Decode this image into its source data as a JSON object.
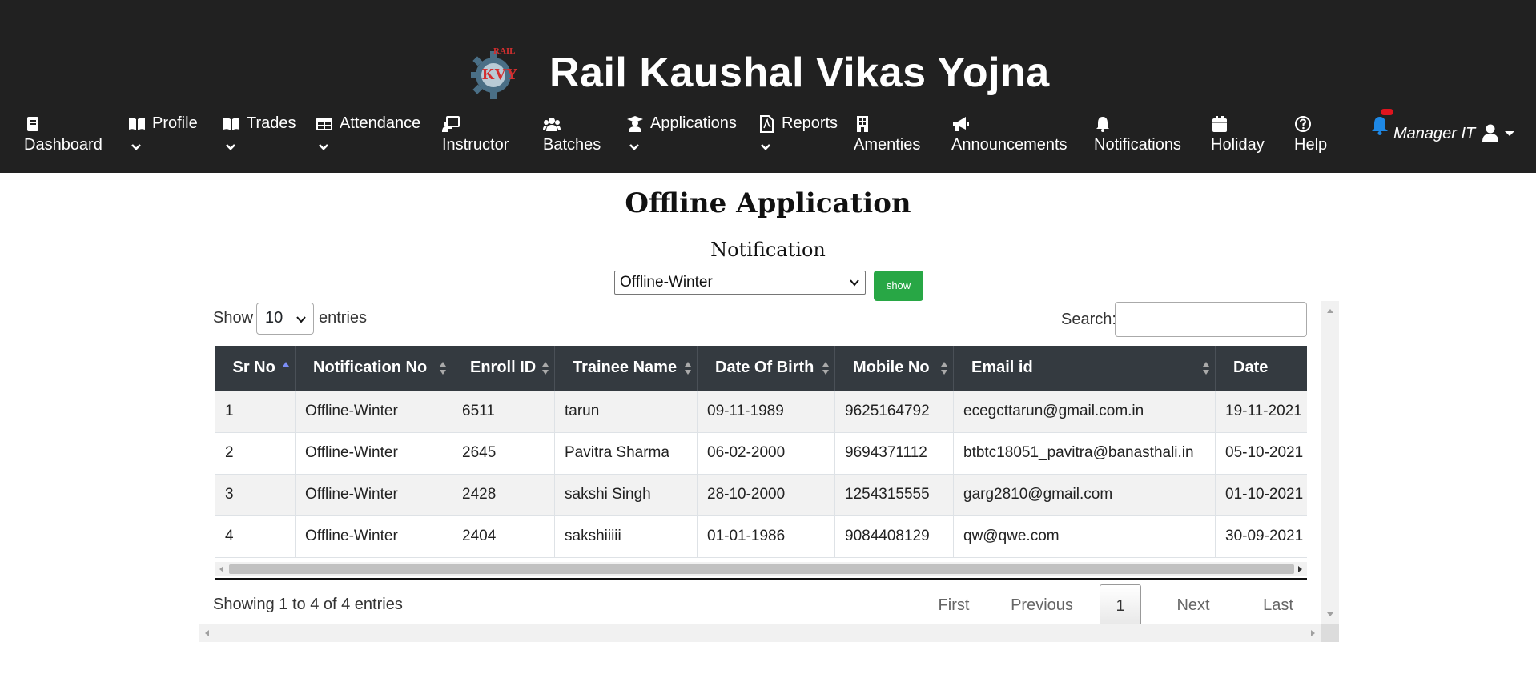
{
  "header": {
    "title": "Rail Kaushal Vikas Yojna",
    "logo": {
      "text_top": "RAIL",
      "text_main": "KVY",
      "icon": "gear-logo-icon"
    }
  },
  "nav": {
    "items": [
      {
        "id": "dashboard",
        "label": "Dashboard",
        "icon": "book-icon",
        "dropdown": false
      },
      {
        "id": "profile",
        "label": "Profile",
        "icon": "open-book-icon",
        "dropdown": true
      },
      {
        "id": "trades",
        "label": "Trades",
        "icon": "open-book-icon",
        "dropdown": true
      },
      {
        "id": "attendance",
        "label": "Attendance",
        "icon": "table-icon",
        "dropdown": true
      },
      {
        "id": "instructor",
        "label": "Instructor",
        "icon": "chalkboard-teacher-icon",
        "dropdown": false
      },
      {
        "id": "batches",
        "label": "Batches",
        "icon": "users-icon",
        "dropdown": false
      },
      {
        "id": "applications",
        "label": "Applications",
        "icon": "user-graduate-icon",
        "dropdown": true
      },
      {
        "id": "reports",
        "label": "Reports",
        "icon": "pdf-file-icon",
        "dropdown": true
      },
      {
        "id": "amenties",
        "label": "Amenties",
        "icon": "building-icon",
        "dropdown": false
      },
      {
        "id": "announcements",
        "label": "Announcements",
        "icon": "bullhorn-icon",
        "dropdown": false
      },
      {
        "id": "notifications",
        "label": "Notifications",
        "icon": "bell-icon",
        "dropdown": false
      },
      {
        "id": "holiday",
        "label": "Holiday",
        "icon": "calendar-icon",
        "dropdown": false
      },
      {
        "id": "help",
        "label": "Help",
        "icon": "question-circle-icon",
        "dropdown": false
      }
    ],
    "user": {
      "name": "Manager IT",
      "icon": "user-icon"
    },
    "colors": {
      "bar": "#212121",
      "bell": "#1e88e5",
      "badge": "#e0141e"
    }
  },
  "page": {
    "title": "Offline Application",
    "notification_label": "Notification",
    "notification_select": "Offline-Winter",
    "show_button": "show"
  },
  "datatable": {
    "length_prefix": "Show",
    "length_value": "10",
    "length_suffix": "entries",
    "search_label": "Search:",
    "search_value": "",
    "columns": [
      "Sr No",
      "Notification No",
      "Enroll ID",
      "Trainee Name",
      "Date Of Birth",
      "Mobile No",
      "Email id",
      "Date"
    ],
    "rows": [
      [
        "1",
        "Offline-Winter",
        "6511",
        "tarun",
        "09-11-1989",
        "9625164792",
        "ecegcttarun@gmail.com.in",
        "19-11-2021"
      ],
      [
        "2",
        "Offline-Winter",
        "2645",
        "Pavitra Sharma",
        "06-02-2000",
        "9694371112",
        "btbtc18051_pavitra@banasthali.in",
        "05-10-2021"
      ],
      [
        "3",
        "Offline-Winter",
        "2428",
        "sakshi Singh",
        "28-10-2000",
        "1254315555",
        "garg2810@gmail.com",
        "01-10-2021"
      ],
      [
        "4",
        "Offline-Winter",
        "2404",
        "sakshiiiii",
        "01-01-1986",
        "9084408129",
        "qw@qwe.com",
        "30-09-2021"
      ]
    ],
    "info": "Showing 1 to 4 of 4 entries",
    "pagination": {
      "first": "First",
      "previous": "Previous",
      "current": "1",
      "next": "Next",
      "last": "Last"
    },
    "colors": {
      "header": "#343a40",
      "stripe": "#f2f2f2",
      "show_button": "#28a745"
    }
  }
}
